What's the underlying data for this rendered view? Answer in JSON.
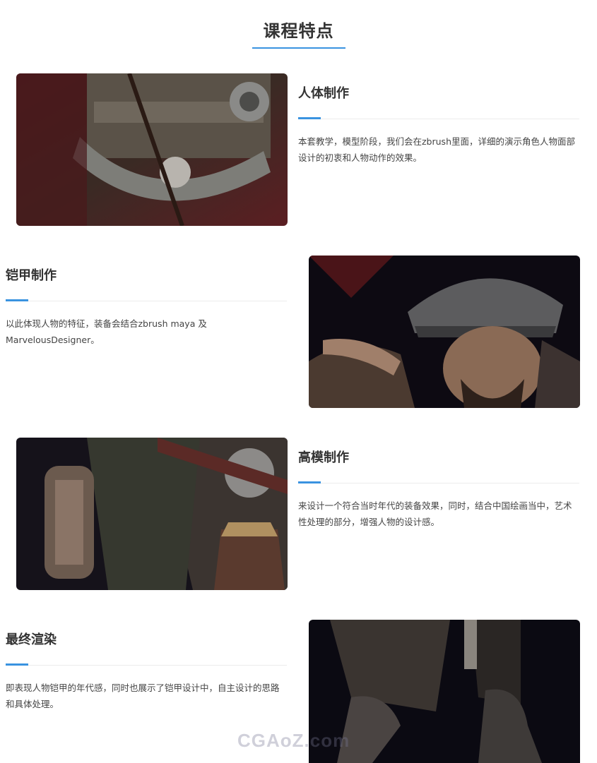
{
  "page": {
    "title": "课程特点"
  },
  "features": [
    {
      "title": "人体制作",
      "description": "本套教学，模型阶段，我们会在zbrush里面，详细的演示角色人物面部设计的初衷和人物动作的效果。",
      "image_icon": "armor-chest-image"
    },
    {
      "title": "铠甲制作",
      "description": "以此体现人物的特征，装备会结合zbrush maya 及MarvelousDesigner。",
      "image_icon": "warrior-portrait-image"
    },
    {
      "title": "高模制作",
      "description": "来设计一个符合当时年代的装备效果，同时，结合中国绘画当中，艺术性处理的部分，增强人物的设计感。",
      "image_icon": "ornament-detail-image"
    },
    {
      "title": "最终渲染",
      "description": "即表现人物铠甲的年代感，同时也展示了铠甲设计中，自主设计的思路和具体处理。",
      "image_icon": "boots-image"
    }
  ],
  "watermark": "CGAoZ.com",
  "colors": {
    "accent": "#3a93e0",
    "text": "#333333"
  }
}
